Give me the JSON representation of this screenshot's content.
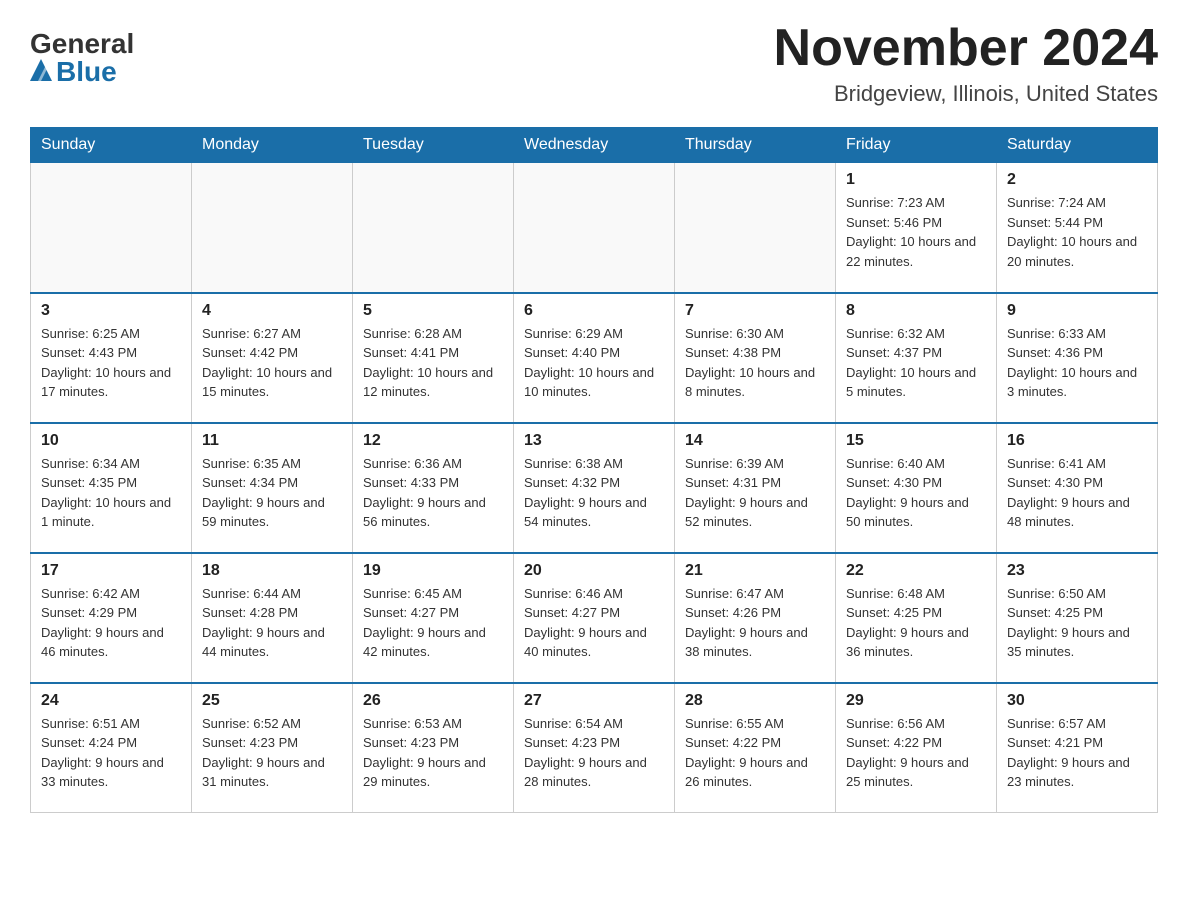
{
  "header": {
    "logo_general": "General",
    "logo_blue": "Blue",
    "month_title": "November 2024",
    "location": "Bridgeview, Illinois, United States"
  },
  "days_of_week": [
    "Sunday",
    "Monday",
    "Tuesday",
    "Wednesday",
    "Thursday",
    "Friday",
    "Saturday"
  ],
  "weeks": [
    [
      {
        "day": "",
        "sunrise": "",
        "sunset": "",
        "daylight": ""
      },
      {
        "day": "",
        "sunrise": "",
        "sunset": "",
        "daylight": ""
      },
      {
        "day": "",
        "sunrise": "",
        "sunset": "",
        "daylight": ""
      },
      {
        "day": "",
        "sunrise": "",
        "sunset": "",
        "daylight": ""
      },
      {
        "day": "",
        "sunrise": "",
        "sunset": "",
        "daylight": ""
      },
      {
        "day": "1",
        "sunrise": "Sunrise: 7:23 AM",
        "sunset": "Sunset: 5:46 PM",
        "daylight": "Daylight: 10 hours and 22 minutes."
      },
      {
        "day": "2",
        "sunrise": "Sunrise: 7:24 AM",
        "sunset": "Sunset: 5:44 PM",
        "daylight": "Daylight: 10 hours and 20 minutes."
      }
    ],
    [
      {
        "day": "3",
        "sunrise": "Sunrise: 6:25 AM",
        "sunset": "Sunset: 4:43 PM",
        "daylight": "Daylight: 10 hours and 17 minutes."
      },
      {
        "day": "4",
        "sunrise": "Sunrise: 6:27 AM",
        "sunset": "Sunset: 4:42 PM",
        "daylight": "Daylight: 10 hours and 15 minutes."
      },
      {
        "day": "5",
        "sunrise": "Sunrise: 6:28 AM",
        "sunset": "Sunset: 4:41 PM",
        "daylight": "Daylight: 10 hours and 12 minutes."
      },
      {
        "day": "6",
        "sunrise": "Sunrise: 6:29 AM",
        "sunset": "Sunset: 4:40 PM",
        "daylight": "Daylight: 10 hours and 10 minutes."
      },
      {
        "day": "7",
        "sunrise": "Sunrise: 6:30 AM",
        "sunset": "Sunset: 4:38 PM",
        "daylight": "Daylight: 10 hours and 8 minutes."
      },
      {
        "day": "8",
        "sunrise": "Sunrise: 6:32 AM",
        "sunset": "Sunset: 4:37 PM",
        "daylight": "Daylight: 10 hours and 5 minutes."
      },
      {
        "day": "9",
        "sunrise": "Sunrise: 6:33 AM",
        "sunset": "Sunset: 4:36 PM",
        "daylight": "Daylight: 10 hours and 3 minutes."
      }
    ],
    [
      {
        "day": "10",
        "sunrise": "Sunrise: 6:34 AM",
        "sunset": "Sunset: 4:35 PM",
        "daylight": "Daylight: 10 hours and 1 minute."
      },
      {
        "day": "11",
        "sunrise": "Sunrise: 6:35 AM",
        "sunset": "Sunset: 4:34 PM",
        "daylight": "Daylight: 9 hours and 59 minutes."
      },
      {
        "day": "12",
        "sunrise": "Sunrise: 6:36 AM",
        "sunset": "Sunset: 4:33 PM",
        "daylight": "Daylight: 9 hours and 56 minutes."
      },
      {
        "day": "13",
        "sunrise": "Sunrise: 6:38 AM",
        "sunset": "Sunset: 4:32 PM",
        "daylight": "Daylight: 9 hours and 54 minutes."
      },
      {
        "day": "14",
        "sunrise": "Sunrise: 6:39 AM",
        "sunset": "Sunset: 4:31 PM",
        "daylight": "Daylight: 9 hours and 52 minutes."
      },
      {
        "day": "15",
        "sunrise": "Sunrise: 6:40 AM",
        "sunset": "Sunset: 4:30 PM",
        "daylight": "Daylight: 9 hours and 50 minutes."
      },
      {
        "day": "16",
        "sunrise": "Sunrise: 6:41 AM",
        "sunset": "Sunset: 4:30 PM",
        "daylight": "Daylight: 9 hours and 48 minutes."
      }
    ],
    [
      {
        "day": "17",
        "sunrise": "Sunrise: 6:42 AM",
        "sunset": "Sunset: 4:29 PM",
        "daylight": "Daylight: 9 hours and 46 minutes."
      },
      {
        "day": "18",
        "sunrise": "Sunrise: 6:44 AM",
        "sunset": "Sunset: 4:28 PM",
        "daylight": "Daylight: 9 hours and 44 minutes."
      },
      {
        "day": "19",
        "sunrise": "Sunrise: 6:45 AM",
        "sunset": "Sunset: 4:27 PM",
        "daylight": "Daylight: 9 hours and 42 minutes."
      },
      {
        "day": "20",
        "sunrise": "Sunrise: 6:46 AM",
        "sunset": "Sunset: 4:27 PM",
        "daylight": "Daylight: 9 hours and 40 minutes."
      },
      {
        "day": "21",
        "sunrise": "Sunrise: 6:47 AM",
        "sunset": "Sunset: 4:26 PM",
        "daylight": "Daylight: 9 hours and 38 minutes."
      },
      {
        "day": "22",
        "sunrise": "Sunrise: 6:48 AM",
        "sunset": "Sunset: 4:25 PM",
        "daylight": "Daylight: 9 hours and 36 minutes."
      },
      {
        "day": "23",
        "sunrise": "Sunrise: 6:50 AM",
        "sunset": "Sunset: 4:25 PM",
        "daylight": "Daylight: 9 hours and 35 minutes."
      }
    ],
    [
      {
        "day": "24",
        "sunrise": "Sunrise: 6:51 AM",
        "sunset": "Sunset: 4:24 PM",
        "daylight": "Daylight: 9 hours and 33 minutes."
      },
      {
        "day": "25",
        "sunrise": "Sunrise: 6:52 AM",
        "sunset": "Sunset: 4:23 PM",
        "daylight": "Daylight: 9 hours and 31 minutes."
      },
      {
        "day": "26",
        "sunrise": "Sunrise: 6:53 AM",
        "sunset": "Sunset: 4:23 PM",
        "daylight": "Daylight: 9 hours and 29 minutes."
      },
      {
        "day": "27",
        "sunrise": "Sunrise: 6:54 AM",
        "sunset": "Sunset: 4:23 PM",
        "daylight": "Daylight: 9 hours and 28 minutes."
      },
      {
        "day": "28",
        "sunrise": "Sunrise: 6:55 AM",
        "sunset": "Sunset: 4:22 PM",
        "daylight": "Daylight: 9 hours and 26 minutes."
      },
      {
        "day": "29",
        "sunrise": "Sunrise: 6:56 AM",
        "sunset": "Sunset: 4:22 PM",
        "daylight": "Daylight: 9 hours and 25 minutes."
      },
      {
        "day": "30",
        "sunrise": "Sunrise: 6:57 AM",
        "sunset": "Sunset: 4:21 PM",
        "daylight": "Daylight: 9 hours and 23 minutes."
      }
    ]
  ]
}
